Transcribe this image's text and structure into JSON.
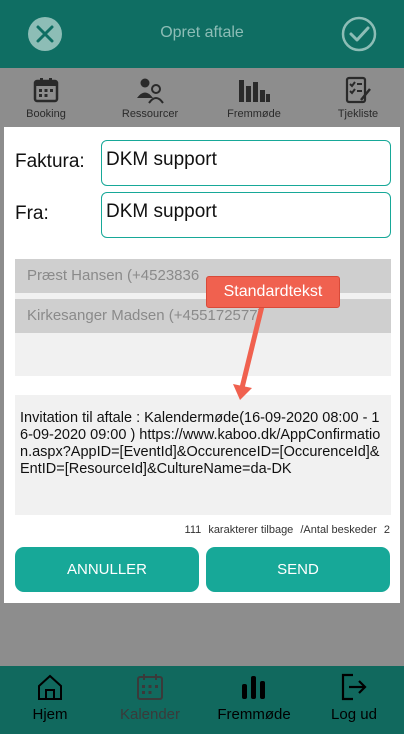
{
  "header": {
    "title": "Opret aftale",
    "close_icon": "close-icon",
    "confirm_icon": "check-icon"
  },
  "tabs": [
    {
      "label": "Booking",
      "icon": "calendar-icon"
    },
    {
      "label": "Ressourcer",
      "icon": "people-icon"
    },
    {
      "label": "Fremmøde",
      "icon": "bar-chart-icon"
    },
    {
      "label": "Tjekliste",
      "icon": "checklist-icon"
    }
  ],
  "modal": {
    "invoice_label": "Faktura:",
    "invoice_value": "DKM support",
    "from_label": "Fra:",
    "from_value": "DKM support",
    "recipients": [
      "Præst Hansen (+4523836",
      "Kirkesanger Madsen (+455172577)"
    ],
    "message": "Invitation til aftale : Kalendermøde(16-09-2020 08:00 - 16-09-2020 09:00 ) https://www.kaboo.dk/AppConfirmation.aspx?AppID=[EventId]&OccurenceID=[OccurenceId]&EntID=[ResourceId]&CultureName=da-DK",
    "chars_remaining": "111",
    "chars_remaining_label": "karakterer tilbage",
    "messages_count_label": "/Antal beskeder",
    "messages_count": "2",
    "cancel_label": "ANNULLER",
    "send_label": "SEND"
  },
  "annotation": {
    "label": "Standardtekst",
    "color": "#f0614f"
  },
  "bottom_nav": [
    {
      "label": "Hjem",
      "icon": "home-icon"
    },
    {
      "label": "Kalender",
      "icon": "calendar-icon"
    },
    {
      "label": "Fremmøde",
      "icon": "bar-chart-icon"
    },
    {
      "label": "Log ud",
      "icon": "logout-icon"
    }
  ],
  "colors": {
    "accent": "#17a898",
    "header": "#0f6e63",
    "overlay": "#8d8d8d"
  }
}
